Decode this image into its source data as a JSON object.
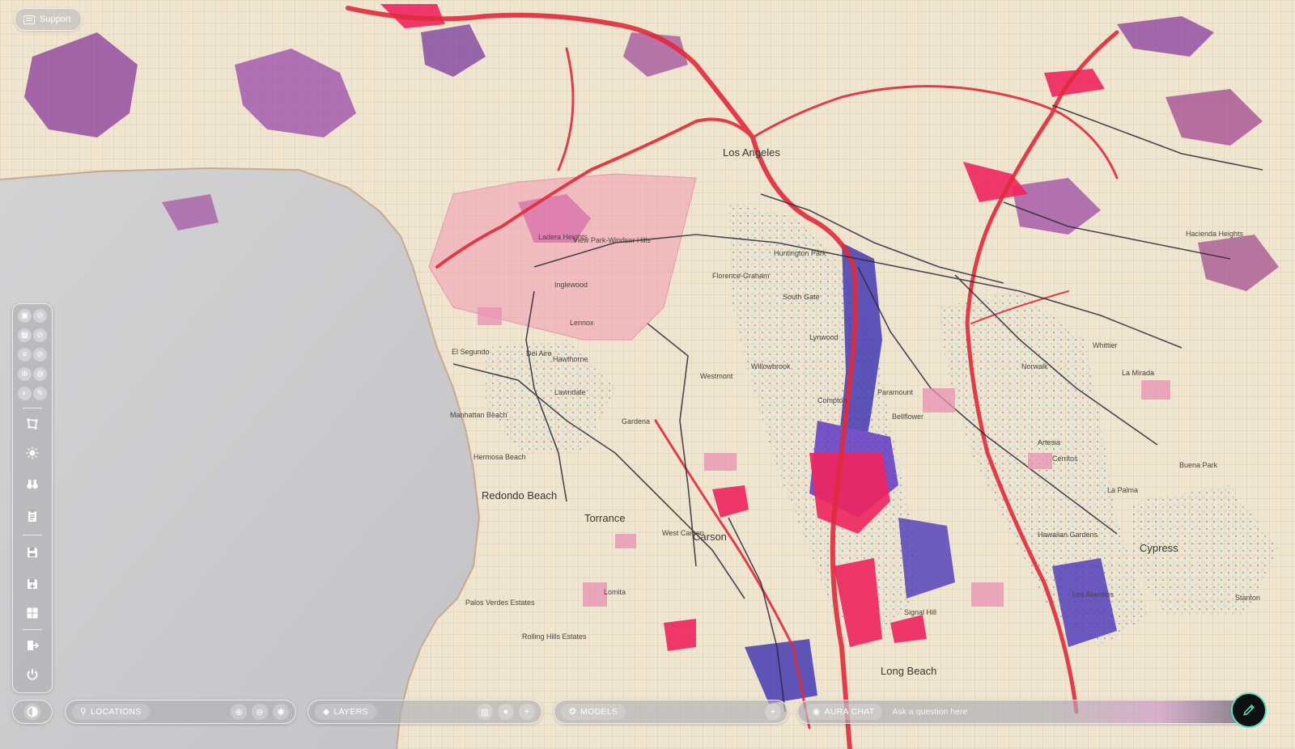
{
  "support": {
    "label": "Support"
  },
  "map": {
    "labels": [
      {
        "name": "Los Angeles",
        "cls": "big"
      },
      {
        "name": "Inglewood"
      },
      {
        "name": "Hawthorne"
      },
      {
        "name": "Lawndale"
      },
      {
        "name": "Manhattan Beach"
      },
      {
        "name": "Hermosa Beach"
      },
      {
        "name": "Redondo Beach",
        "cls": "big"
      },
      {
        "name": "Torrance",
        "cls": "big"
      },
      {
        "name": "Gardena"
      },
      {
        "name": "Carson",
        "cls": "big"
      },
      {
        "name": "Lomita"
      },
      {
        "name": "Palos Verdes Estates"
      },
      {
        "name": "Rolling Hills Estates"
      },
      {
        "name": "Long Beach",
        "cls": "big"
      },
      {
        "name": "Signal Hill"
      },
      {
        "name": "Cypress"
      },
      {
        "name": "Norwalk"
      },
      {
        "name": "Whittier"
      },
      {
        "name": "South Gate"
      },
      {
        "name": "Huntington Park"
      },
      {
        "name": "Buena Park"
      },
      {
        "name": "La Palma"
      },
      {
        "name": "Los Alamitos"
      },
      {
        "name": "Stanton"
      },
      {
        "name": "La Mirada"
      },
      {
        "name": "Lynwood"
      },
      {
        "name": "Bellflower"
      },
      {
        "name": "Artesia"
      },
      {
        "name": "Lennox"
      },
      {
        "name": "View Park-Windsor Hills"
      },
      {
        "name": "Ladera Heights"
      },
      {
        "name": "Florence-Graham"
      },
      {
        "name": "Paramount"
      },
      {
        "name": "Compton"
      },
      {
        "name": "Cerritos"
      },
      {
        "name": "West Carson"
      },
      {
        "name": "Hawaiian Gardens"
      },
      {
        "name": "El Segundo"
      },
      {
        "name": "Westmont"
      },
      {
        "name": "Del Aire"
      },
      {
        "name": "Hacienda Heights"
      },
      {
        "name": "Willowbrook"
      }
    ]
  },
  "toolbar": {
    "pairs": [
      {
        "a": "street-view-icon",
        "b": "no-street-view-icon"
      },
      {
        "a": "3d-buildings-icon",
        "b": "no-buildings-icon"
      },
      {
        "a": "labels-icon",
        "b": "no-labels-icon"
      },
      {
        "a": "grid-globe-icon",
        "b": "globe-icon"
      },
      {
        "a": "terrain-icon",
        "b": "draw-tool-icon"
      }
    ],
    "tools": [
      {
        "name": "polygon-select-icon"
      },
      {
        "name": "sun-icon"
      },
      {
        "name": "binoculars-icon"
      },
      {
        "name": "clipboard-icon"
      },
      {
        "name": "save-icon"
      },
      {
        "name": "save-as-icon"
      },
      {
        "name": "dashboard-icon"
      },
      {
        "name": "export-icon"
      },
      {
        "name": "power-icon"
      }
    ]
  },
  "bottom": {
    "theme_toggle": "contrast-icon",
    "locations": "LOCATIONS",
    "layers": "LAYERS",
    "models": "MODELS",
    "aura_chat": "AURA CHAT",
    "chat_placeholder": "Ask a question here"
  }
}
